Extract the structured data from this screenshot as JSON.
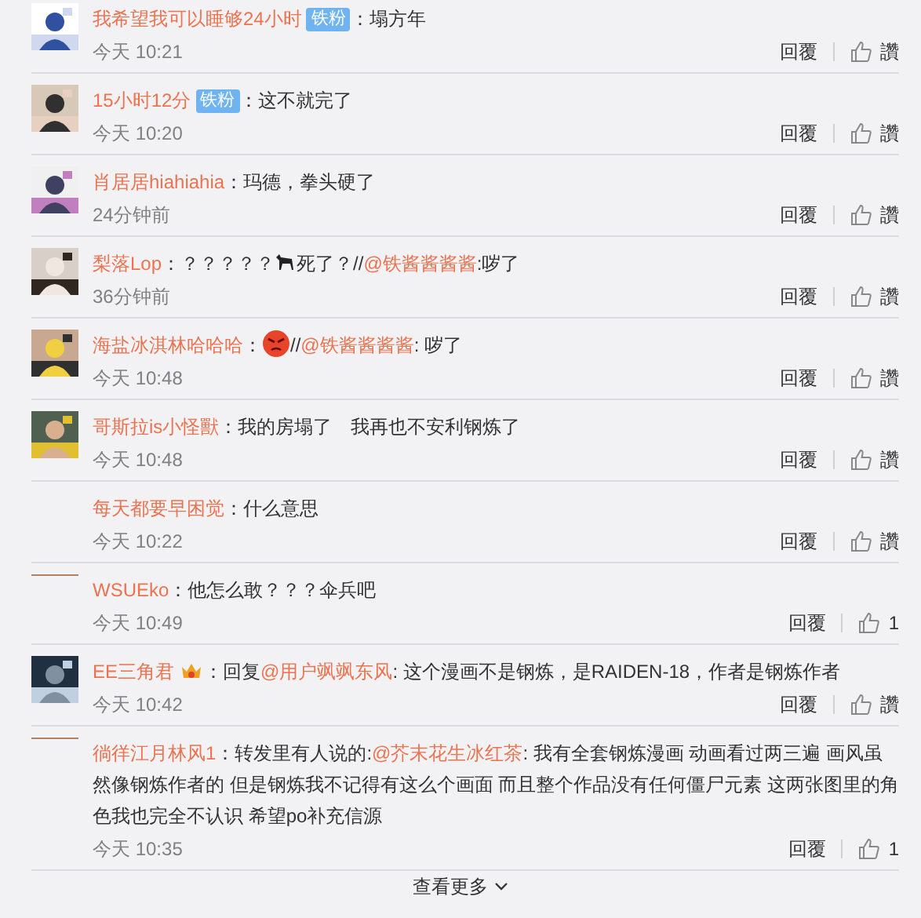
{
  "comments": [
    {
      "name": "我希望我可以睡够24小时",
      "badge": "铁粉",
      "content": [
        {
          "kind": "text",
          "text": "：塌方年"
        }
      ],
      "time": "今天 10:21",
      "reply": "回覆",
      "like": "讚"
    },
    {
      "name": "15小时12分",
      "badge": "铁粉",
      "content": [
        {
          "kind": "text",
          "text": "：这不就完了"
        }
      ],
      "time": "今天 10:20",
      "reply": "回覆",
      "like": "讚"
    },
    {
      "name": "肖居居hiahiahia",
      "content": [
        {
          "kind": "text",
          "text": "：玛德，拳头硬了"
        }
      ],
      "time": "24分钟前",
      "reply": "回覆",
      "like": "讚"
    },
    {
      "name": "梨落Lop",
      "content": [
        {
          "kind": "text",
          "text": "：？？？？？"
        },
        {
          "kind": "dog"
        },
        {
          "kind": "text",
          "text": "死了？//"
        },
        {
          "kind": "mention",
          "text": "@铁酱酱酱酱"
        },
        {
          "kind": "text",
          "text": ":哕了"
        }
      ],
      "time": "36分钟前",
      "reply": "回覆",
      "like": "讚"
    },
    {
      "name": "海盐冰淇林哈哈哈",
      "content": [
        {
          "kind": "text",
          "text": "："
        },
        {
          "kind": "angry"
        },
        {
          "kind": "text",
          "text": "//"
        },
        {
          "kind": "mention",
          "text": "@铁酱酱酱酱"
        },
        {
          "kind": "text",
          "text": ": 哕了"
        }
      ],
      "time": "今天 10:48",
      "reply": "回覆",
      "like": "讚"
    },
    {
      "name": "哥斯拉is小怪獸",
      "content": [
        {
          "kind": "text",
          "text": "：我的房塌了　我再也不安利钢炼了"
        }
      ],
      "time": "今天 10:48",
      "reply": "回覆",
      "like": "讚"
    },
    {
      "name": "每天都要早困觉",
      "content": [
        {
          "kind": "text",
          "text": "：什么意思"
        }
      ],
      "time": "今天 10:22",
      "reply": "回覆",
      "like": "讚"
    },
    {
      "avatar": {
        "kind": "line"
      },
      "name": "WSUEko",
      "content": [
        {
          "kind": "text",
          "text": "：他怎么敢？？？伞兵吧"
        }
      ],
      "time": "今天 10:49",
      "reply": "回覆",
      "like": "1"
    },
    {
      "name": "EE三角君",
      "crown": true,
      "content": [
        {
          "kind": "text",
          "text": "：回复"
        },
        {
          "kind": "mention",
          "text": "@用户飒飒东风"
        },
        {
          "kind": "text",
          "text": ": 这个漫画不是钢炼，是RAIDEN-18，作者是钢炼作者"
        }
      ],
      "time": "今天 10:42",
      "reply": "回覆",
      "like": "讚"
    },
    {
      "avatar": {
        "kind": "line"
      },
      "name": "徜徉江月林风1",
      "content": [
        {
          "kind": "text",
          "text": "：转发里有人说的:"
        },
        {
          "kind": "mention",
          "text": "@芥末花生冰红茶"
        },
        {
          "kind": "text",
          "text": ": 我有全套钢炼漫画 动画看过两三遍 画风虽然像钢炼作者的 但是钢炼我不记得有这么个画面 而且整个作品没有任何僵尸元素 这两张图里的角色我也完全不认识 希望po补充信源"
        }
      ],
      "time": "今天 10:35",
      "reply": "回覆",
      "like": "1"
    }
  ],
  "more": "查看更多"
}
